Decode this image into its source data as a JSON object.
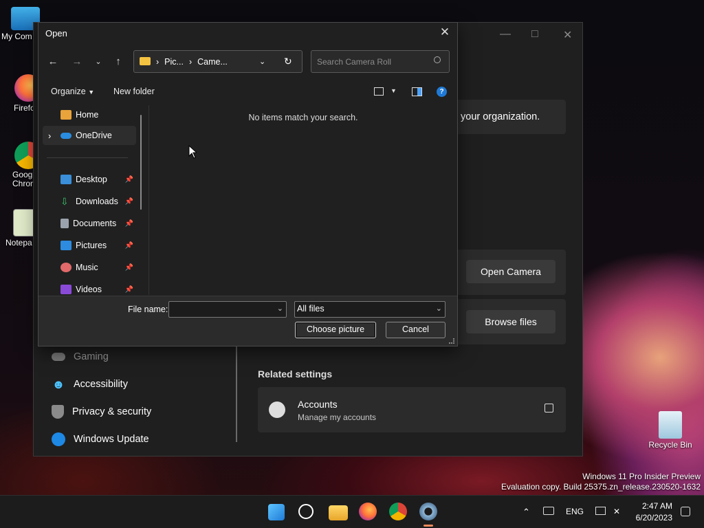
{
  "desktop": {
    "icons": [
      {
        "label": "My Com"
      },
      {
        "label": "Firefo"
      },
      {
        "label": "Goog Chron"
      },
      {
        "label": "Notepa"
      },
      {
        "label": "Recycle Bin"
      }
    ],
    "watermark_line1": "Windows 11 Pro Insider Preview",
    "watermark_line2": "Evaluation copy. Build 25375.zn_release.230520-1632"
  },
  "settings": {
    "org_text": "your organization.",
    "open_camera": "Open Camera",
    "browse_files": "Browse files",
    "related_settings": "Related settings",
    "accounts_title": "Accounts",
    "accounts_sub": "Manage my accounts",
    "nav": [
      {
        "label": "Gaming"
      },
      {
        "label": "Accessibility"
      },
      {
        "label": "Privacy & security"
      },
      {
        "label": "Windows Update"
      }
    ]
  },
  "dialog": {
    "title": "Open",
    "breadcrumb": [
      "Pic...",
      "Came..."
    ],
    "search_placeholder": "Search Camera Roll",
    "organize": "Organize",
    "new_folder": "New folder",
    "empty_message": "No items match your search.",
    "tree": [
      {
        "label": "Home"
      },
      {
        "label": "OneDrive"
      },
      {
        "label": "Desktop"
      },
      {
        "label": "Downloads"
      },
      {
        "label": "Documents"
      },
      {
        "label": "Pictures"
      },
      {
        "label": "Music"
      },
      {
        "label": "Videos"
      }
    ],
    "file_name_label": "File name:",
    "file_name_value": "",
    "filter_value": "All files",
    "choose_button": "Choose picture",
    "cancel_button": "Cancel"
  },
  "taskbar": {
    "language": "ENG",
    "time": "2:47 AM",
    "date": "6/20/2023"
  }
}
